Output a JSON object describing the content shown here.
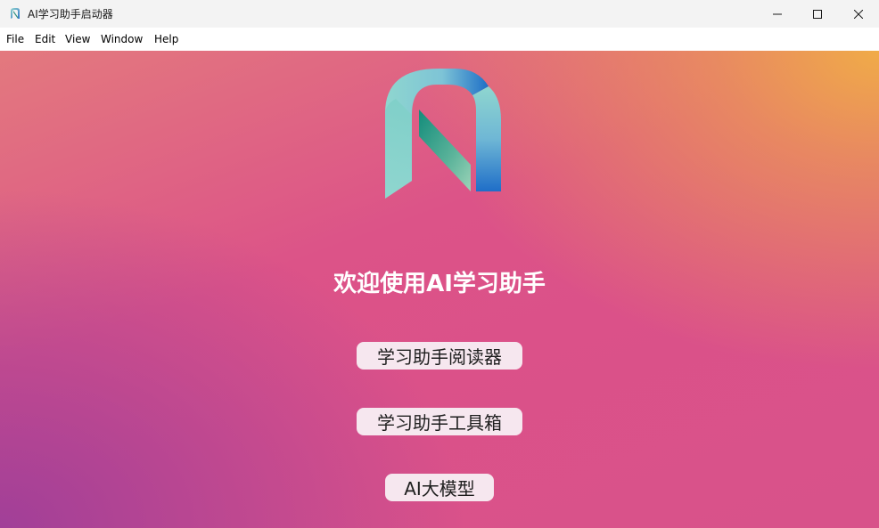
{
  "window": {
    "title": "AI学习助手启动器",
    "app_icon": "n-logo-icon",
    "controls": {
      "minimize_icon": "minimize-icon",
      "maximize_icon": "maximize-icon",
      "close_icon": "close-icon"
    }
  },
  "menubar": {
    "items": [
      "File",
      "Edit",
      "View",
      "Window",
      "Help"
    ]
  },
  "main": {
    "logo": "n-logo-icon",
    "welcome_title": "欢迎使用AI学习助手",
    "buttons": [
      {
        "label": "学习助手阅读器"
      },
      {
        "label": "学习助手工具箱"
      },
      {
        "label": "AI大模型"
      }
    ]
  },
  "colors": {
    "gradient_top_right": "#f0ab48",
    "gradient_center": "#db5189",
    "gradient_bottom_left": "#a13f98",
    "button_background": "#f6e7ef",
    "title_text": "#ffffff"
  }
}
